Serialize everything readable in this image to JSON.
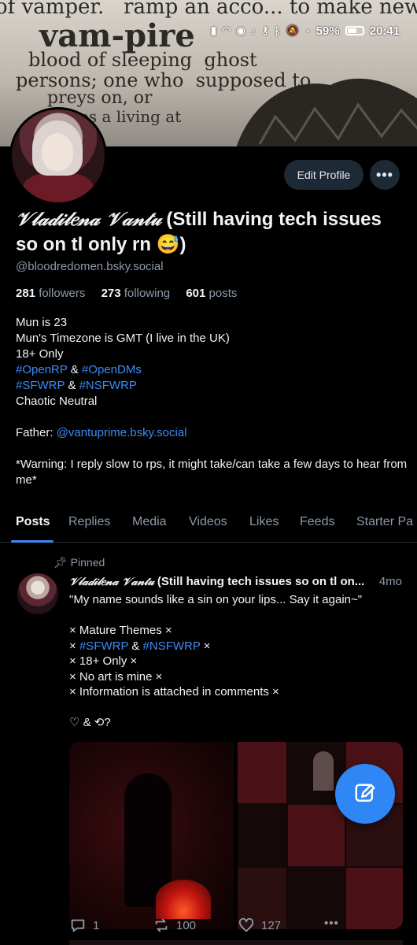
{
  "status_bar": {
    "battery_percent": "59%",
    "time": "20:41"
  },
  "header": {
    "edit_profile_label": "Edit Profile",
    "more_label": "•••"
  },
  "profile": {
    "display_name_fancy": "𝒱𝓁𝒶𝒹𝒾𝓁𝑒𝓃𝒶 𝒱𝒶𝓃𝓉𝓊",
    "display_name_rest": " (Still having tech issues so on tl only rn 😅)",
    "handle": "@bloodredomen.bsky.social",
    "followers_count": "281",
    "followers_label": "followers",
    "following_count": "273",
    "following_label": "following",
    "posts_count": "601",
    "posts_label": "posts"
  },
  "bio": {
    "line1": "Mun is 23",
    "line2": "Mun's Timezone is GMT (I live in the UK)",
    "line3": "18+ Only",
    "tag_openrp": "#OpenRP",
    "amp": " & ",
    "tag_opendms": "#OpenDMs",
    "tag_sfwrp": "#SFWRP",
    "tag_nsfwrp": "#NSFWRP",
    "line6": "Chaotic Neutral",
    "father_label": "Father: ",
    "father_link": "@vantuprime.bsky.social",
    "warning": "*Warning: I reply slow to rps, it might take/can take a few days to hear from me*"
  },
  "tabs": [
    "Posts",
    "Replies",
    "Media",
    "Videos",
    "Likes",
    "Feeds",
    "Starter Pa"
  ],
  "post": {
    "pinned_label": "Pinned",
    "author_fancy": "𝒱𝓁𝒶𝒹𝒾𝓁𝑒𝓃𝒶 𝒱𝒶𝓃𝓉𝓊",
    "author_rest": " (Still having tech issues so on tl on...",
    "time": "4mo",
    "quote": "\"My name sounds like a sin on your lips... Say it again~\"",
    "item1": "× Mature Themes ×",
    "item2_prefix": "× ",
    "item2_tag1": "#SFWRP",
    "item2_amp": " & ",
    "item2_tag2": "#NSFWRP",
    "item2_suffix": " ×",
    "item3": "× 18+ Only ×",
    "item4": "× No art is mine ×",
    "item5": "× Information is attached in comments ×",
    "closing": "♡ & ⟲?",
    "reply_count": "1",
    "repost_count": "100",
    "like_count": "127"
  },
  "colors": {
    "accent": "#3d8bf2",
    "fab": "#2f86f5",
    "muted": "#8c9aab",
    "button_bg": "#1e2936"
  }
}
